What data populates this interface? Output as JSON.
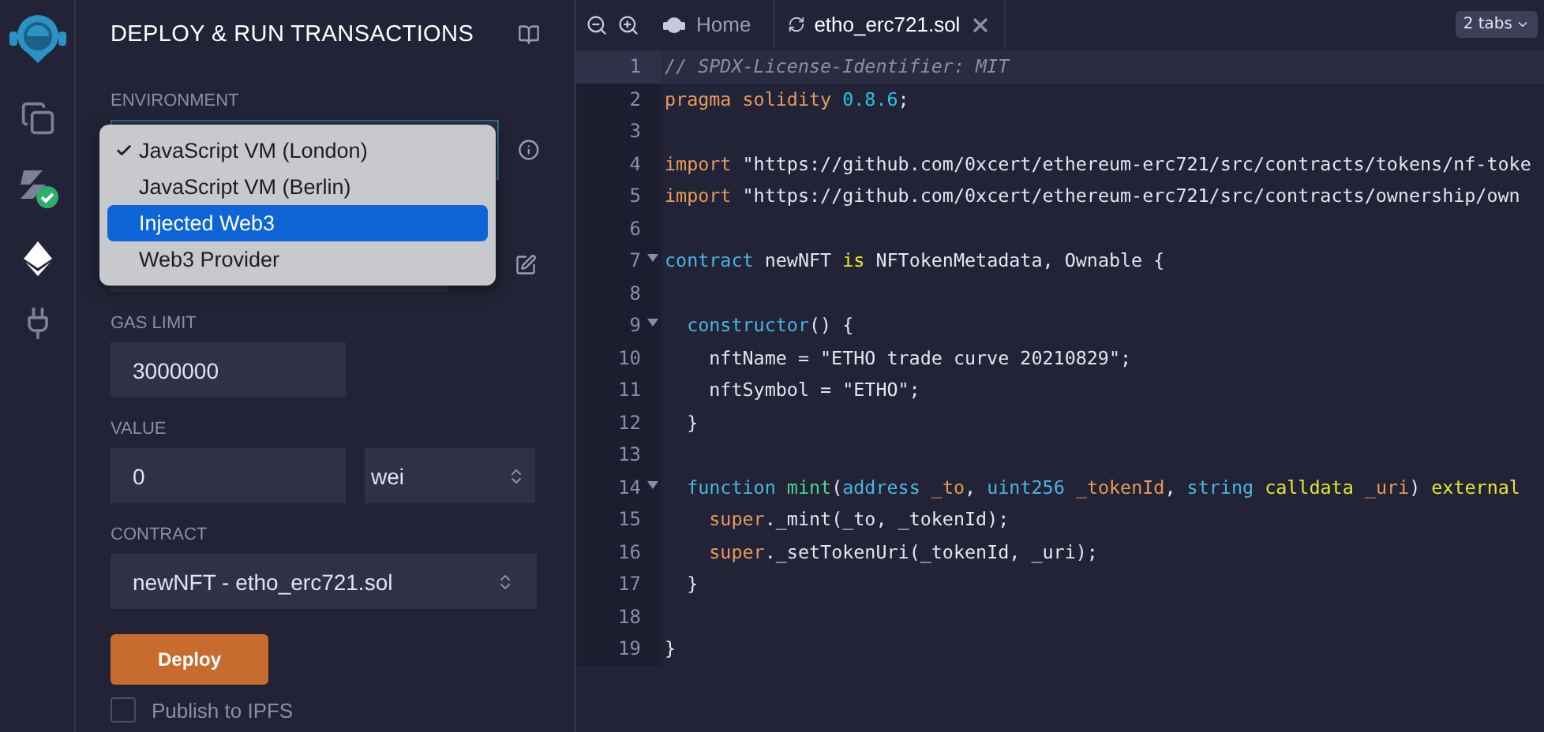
{
  "panel": {
    "title": "DEPLOY & RUN TRANSACTIONS"
  },
  "environment": {
    "label": "ENVIRONMENT",
    "options": [
      {
        "label": "JavaScript VM (London)",
        "checked": true,
        "selected": false
      },
      {
        "label": "JavaScript VM (Berlin)",
        "checked": false,
        "selected": false
      },
      {
        "label": "Injected Web3",
        "checked": false,
        "selected": true
      },
      {
        "label": "Web3 Provider",
        "checked": false,
        "selected": false
      }
    ]
  },
  "gas_limit": {
    "label": "GAS LIMIT",
    "value": "3000000"
  },
  "value": {
    "label": "VALUE",
    "value": "0",
    "unit": "wei"
  },
  "contract": {
    "label": "CONTRACT",
    "value": "newNFT - etho_erc721.sol"
  },
  "deploy_button": "Deploy",
  "publish": {
    "label": "Publish to IPFS",
    "checked": false
  },
  "editor": {
    "tabs": [
      {
        "label": "Home",
        "selected": false,
        "closable": false
      },
      {
        "label": "etho_erc721.sol",
        "selected": true,
        "closable": true
      }
    ],
    "tabs_count": "2 tabs",
    "lines": [
      {
        "number": "1",
        "active": true,
        "fold": false,
        "tokens": [
          {
            "text": "// SPDX-License-Identifier: MIT",
            "kind": "comment"
          }
        ]
      },
      {
        "number": "2",
        "active": false,
        "fold": false,
        "tokens": [
          {
            "text": "pragma solidity ",
            "kind": "keyword"
          },
          {
            "text": "0.8.6",
            "kind": "number"
          },
          {
            "text": ";",
            "kind": "plain"
          }
        ]
      },
      {
        "number": "3",
        "active": false,
        "fold": false
      },
      {
        "number": "4",
        "active": false,
        "fold": false,
        "tokens": [
          {
            "text": "import",
            "kind": "keyword"
          },
          {
            "text": " \"https://github.com/0xcert/ethereum-erc721/src/contracts/tokens/nf-toke",
            "kind": "plain"
          }
        ]
      },
      {
        "number": "5",
        "active": false,
        "fold": false,
        "tokens": [
          {
            "text": "import",
            "kind": "keyword"
          },
          {
            "text": " \"https://github.com/0xcert/ethereum-erc721/src/contracts/ownership/own",
            "kind": "plain"
          }
        ]
      },
      {
        "number": "6",
        "active": false,
        "fold": false
      },
      {
        "number": "7",
        "active": false,
        "fold": true,
        "tokens": [
          {
            "text": "contract",
            "kind": "type"
          },
          {
            "text": " newNFT ",
            "kind": "plain"
          },
          {
            "text": "is",
            "kind": "modifier"
          },
          {
            "text": " NFTokenMetadata, Ownable {",
            "kind": "plain"
          }
        ]
      },
      {
        "number": "8",
        "active": false,
        "fold": false
      },
      {
        "number": "9",
        "active": false,
        "fold": true,
        "tokens": [
          {
            "text": "  constructor",
            "kind": "type"
          },
          {
            "text": "() {",
            "kind": "plain"
          }
        ]
      },
      {
        "number": "10",
        "active": false,
        "fold": false,
        "tokens": [
          {
            "text": "    nftName = \"ETHO trade curve 20210829\";",
            "kind": "plain"
          }
        ]
      },
      {
        "number": "11",
        "active": false,
        "fold": false,
        "tokens": [
          {
            "text": "    nftSymbol = \"ETHO\";",
            "kind": "plain"
          }
        ]
      },
      {
        "number": "12",
        "active": false,
        "fold": false,
        "tokens": [
          {
            "text": "  }",
            "kind": "plain"
          }
        ]
      },
      {
        "number": "13",
        "active": false,
        "fold": false
      },
      {
        "number": "14",
        "active": false,
        "fold": true,
        "tokens": [
          {
            "text": "  function",
            "kind": "type"
          },
          {
            "text": " mint",
            "kind": "function"
          },
          {
            "text": "(",
            "kind": "plain"
          },
          {
            "text": "address",
            "kind": "type"
          },
          {
            "text": " _to",
            "kind": "keyword"
          },
          {
            "text": ", ",
            "kind": "plain"
          },
          {
            "text": "uint256",
            "kind": "type"
          },
          {
            "text": " _tokenId",
            "kind": "keyword"
          },
          {
            "text": ", ",
            "kind": "plain"
          },
          {
            "text": "string",
            "kind": "type"
          },
          {
            "text": " calldata",
            "kind": "modifier"
          },
          {
            "text": " _uri",
            "kind": "keyword"
          },
          {
            "text": ") ",
            "kind": "plain"
          },
          {
            "text": "external",
            "kind": "modifier"
          }
        ]
      },
      {
        "number": "15",
        "active": false,
        "fold": false,
        "tokens": [
          {
            "text": "    super",
            "kind": "keyword"
          },
          {
            "text": "._mint(_to, _tokenId);",
            "kind": "plain"
          }
        ]
      },
      {
        "number": "16",
        "active": false,
        "fold": false,
        "tokens": [
          {
            "text": "    super",
            "kind": "keyword"
          },
          {
            "text": "._setTokenUri(_tokenId, _uri);",
            "kind": "plain"
          }
        ]
      },
      {
        "number": "17",
        "active": false,
        "fold": false,
        "tokens": [
          {
            "text": "  }",
            "kind": "plain"
          }
        ]
      },
      {
        "number": "18",
        "active": false,
        "fold": false
      },
      {
        "number": "19",
        "active": false,
        "fold": false,
        "tokens": [
          {
            "text": "}",
            "kind": "plain"
          }
        ]
      }
    ]
  }
}
